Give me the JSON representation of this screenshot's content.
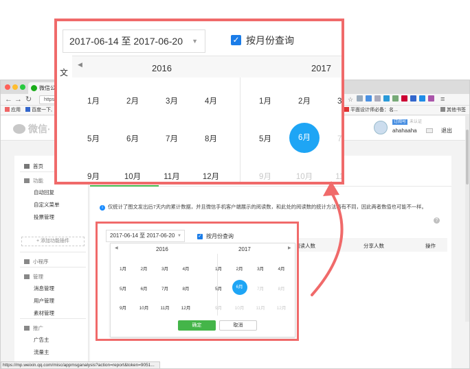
{
  "browser": {
    "tab_title": "微信公...",
    "url": "https",
    "bookmarks": [
      "应用",
      "百度一下,",
      "平面设计师必备：名...",
      "其他书签"
    ],
    "status_url": "https://mp.weixin.qq.com/misc/appmsganalysis?action=report&token=9051..."
  },
  "wx": {
    "logo": "微信·",
    "user_tag": "订阅号",
    "user_tag2": "未认证",
    "username": "ahahaaha",
    "logout": "退出"
  },
  "sidebar": {
    "home": "首页",
    "func_head": "功能",
    "func_items": [
      "自动回复",
      "自定义菜单",
      "投票管理"
    ],
    "add_plugin": "+ 添加功能插件",
    "mini": "小程序",
    "manage_head": "管理",
    "manage_items": [
      "消息管理",
      "用户管理",
      "素材管理"
    ],
    "promo_head": "推广",
    "promo_items": [
      "广告主",
      "流量主"
    ]
  },
  "content": {
    "notice": "仅统计了图文发出后7天内的累计数据，并且微信手机客户端展示的阅读数，和此处的阅读数的统计方法略有不同，因此两者数值也可能不一样。",
    "col_wen": "文",
    "col_read": "阅读人数",
    "col_share": "分享人数",
    "col_ops": "操作",
    "help": "?"
  },
  "picker": {
    "date_range": "2017-06-14 至 2017-06-20",
    "by_month_label": "按月份查询",
    "by_month_checked": true,
    "year_left": "2016",
    "year_right": "2017",
    "months_2016": [
      "1月",
      "2月",
      "3月",
      "4月",
      "5月",
      "6月",
      "7月",
      "8月",
      "9月",
      "10月",
      "11月",
      "12月"
    ],
    "months_2017": [
      "1月",
      "2月",
      "3月",
      "4月",
      "5月",
      "6月",
      "7月",
      "8月",
      "9月",
      "10月",
      "11月",
      "12月"
    ],
    "selected_2017_index": 5,
    "confirm": "确定",
    "cancel": "取消",
    "highlight_color": "#1ea5f5",
    "confirm_color": "#44b549",
    "frame_color": "#f06a6a"
  }
}
